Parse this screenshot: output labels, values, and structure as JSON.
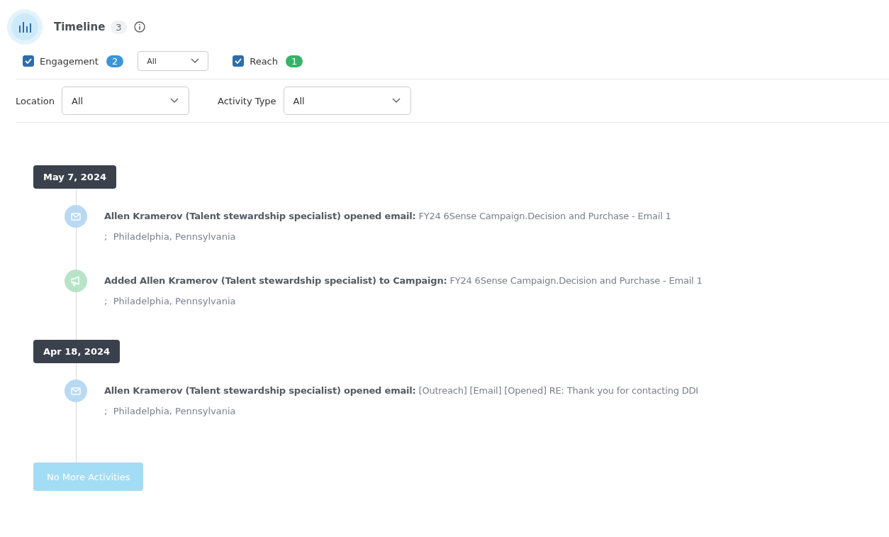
{
  "header": {
    "title": "Timeline",
    "count": "3"
  },
  "filters": [
    {
      "label": "Engagement",
      "checked": true,
      "count": "2",
      "color": "#3b95d9",
      "dropdown": "All"
    },
    {
      "label": "Reach",
      "checked": true,
      "count": "1",
      "color": "#36b36a"
    }
  ],
  "selects": [
    {
      "label": "Location",
      "value": "All"
    },
    {
      "label": "Activity Type",
      "value": "All"
    }
  ],
  "timeline": [
    {
      "date": "May 7, 2024",
      "activities": [
        {
          "kind": "email",
          "text": "**Allen Kramerov (Talent stewardship specialist) opened email:**  FY24 6Sense Campaign.Decision and Purchase - Email 1",
          "location": ";  Philadelphia, Pennsylvania"
        },
        {
          "kind": "campaign",
          "text": "**Added Allen Kramerov (Talent stewardship specialist) to Campaign:**  FY24 6Sense Campaign.Decision and Purchase - Email 1",
          "location": ";  Philadelphia, Pennsylvania"
        }
      ]
    },
    {
      "date": "Apr 18, 2024",
      "activities": [
        {
          "kind": "email",
          "text": "**Allen Kramerov (Talent stewardship specialist) opened email:**  [Outreach] [Email] [Opened] RE: Thank you for contacting DDI",
          "location": ";  Philadelphia, Pennsylvania"
        }
      ]
    }
  ],
  "more_button": {
    "label": "No More Activities",
    "disabled": true
  }
}
